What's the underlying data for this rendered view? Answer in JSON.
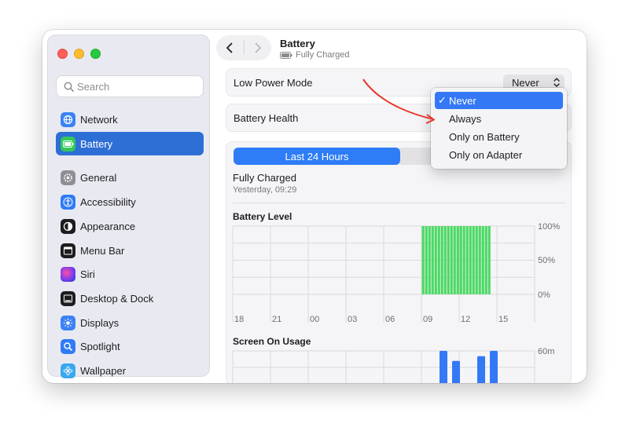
{
  "header": {
    "title": "Battery",
    "subtitle": "Fully Charged"
  },
  "sidebar": {
    "search_placeholder": "Search",
    "items": [
      {
        "label": "Network",
        "icon": "globe-icon",
        "color": "#3b82f6"
      },
      {
        "label": "Battery",
        "icon": "battery-icon",
        "color": "#34c759",
        "active": true
      },
      {
        "label": "General",
        "icon": "gear-icon",
        "color": "#8e8e93"
      },
      {
        "label": "Accessibility",
        "icon": "accessibility-icon",
        "color": "#2f7cf6"
      },
      {
        "label": "Appearance",
        "icon": "appearance-icon",
        "color": "#1d1d1f"
      },
      {
        "label": "Menu Bar",
        "icon": "menubar-icon",
        "color": "#1d1d1f"
      },
      {
        "label": "Siri",
        "icon": "siri-icon",
        "color": "#7a3cf0"
      },
      {
        "label": "Desktop & Dock",
        "icon": "dock-icon",
        "color": "#1d1d1f"
      },
      {
        "label": "Displays",
        "icon": "sun-icon",
        "color": "#3b82f6"
      },
      {
        "label": "Spotlight",
        "icon": "magnifier-icon",
        "color": "#2f7cf6"
      },
      {
        "label": "Wallpaper",
        "icon": "flower-icon",
        "color": "#3aa8f0"
      }
    ]
  },
  "settings": {
    "low_power_label": "Low Power Mode",
    "low_power_value": "Never",
    "battery_health_label": "Battery Health"
  },
  "dropdown": {
    "options": [
      "Never",
      "Always",
      "Only on Battery",
      "Only on Adapter"
    ],
    "selected_index": 0,
    "check_mark": "✓"
  },
  "graph": {
    "segment_active": "Last 24 Hours",
    "status_title": "Fully Charged",
    "status_time": "Yesterday, 09:29",
    "battery_level_title": "Battery Level",
    "screen_usage_title": "Screen On Usage"
  },
  "chart_data": [
    {
      "type": "bar",
      "title": "Battery Level",
      "categories": [
        "18",
        "21",
        "00",
        "03",
        "06",
        "09",
        "12",
        "15"
      ],
      "y_ticks": [
        "100%",
        "50%",
        "0%"
      ],
      "ylim": [
        0,
        100
      ],
      "bar_color": "#4cd964",
      "values_description_hours": "Full charge bars from about 09:00 to 14:30",
      "bars": [
        {
          "hour": 9.0,
          "value": 100
        },
        {
          "hour": 9.25,
          "value": 100
        },
        {
          "hour": 9.5,
          "value": 100
        },
        {
          "hour": 9.75,
          "value": 100
        },
        {
          "hour": 10.0,
          "value": 100
        },
        {
          "hour": 10.25,
          "value": 100
        },
        {
          "hour": 10.5,
          "value": 100
        },
        {
          "hour": 10.75,
          "value": 100
        },
        {
          "hour": 11.0,
          "value": 100
        },
        {
          "hour": 11.25,
          "value": 100
        },
        {
          "hour": 11.5,
          "value": 100
        },
        {
          "hour": 11.75,
          "value": 100
        },
        {
          "hour": 12.0,
          "value": 100
        },
        {
          "hour": 12.25,
          "value": 100
        },
        {
          "hour": 12.5,
          "value": 100
        },
        {
          "hour": 12.75,
          "value": 100
        },
        {
          "hour": 13.0,
          "value": 100
        },
        {
          "hour": 13.25,
          "value": 100
        },
        {
          "hour": 13.5,
          "value": 100
        },
        {
          "hour": 13.75,
          "value": 100
        },
        {
          "hour": 14.0,
          "value": 100
        },
        {
          "hour": 14.25,
          "value": 100
        }
      ]
    },
    {
      "type": "bar",
      "title": "Screen On Usage",
      "y_ticks": [
        "60m"
      ],
      "ylim": [
        0,
        60
      ],
      "bar_color": "#3478f6",
      "bars": [
        {
          "hour": 10.5,
          "value": 60
        },
        {
          "hour": 11.5,
          "value": 45
        },
        {
          "hour": 13.5,
          "value": 52
        },
        {
          "hour": 14.5,
          "value": 60
        }
      ]
    }
  ]
}
